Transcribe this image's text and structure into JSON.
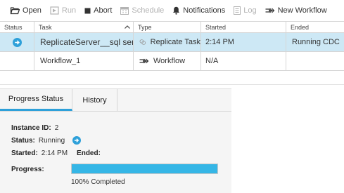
{
  "toolbar": {
    "open": "Open",
    "run": "Run",
    "abort": "Abort",
    "schedule": "Schedule",
    "notifications": "Notifications",
    "log": "Log",
    "new_workflow": "New Workflow"
  },
  "grid": {
    "columns": [
      "Status",
      "Task",
      "Type",
      "Started",
      "Ended"
    ],
    "rows": [
      {
        "task": "ReplicateServer__sql server",
        "type": "Replicate Task",
        "started": "2:14 PM",
        "ended": "Running CDC"
      },
      {
        "task": "Workflow_1",
        "type": "Workflow",
        "started": "N/A",
        "ended": ""
      }
    ]
  },
  "tabs": [
    "Progress Status",
    "History"
  ],
  "details": {
    "instance_label": "Instance ID:",
    "instance_value": "2",
    "status_label": "Status:",
    "status_value": "Running",
    "started_label": "Started:",
    "started_value": "2:14 PM",
    "ended_label": "Ended:",
    "progress_label": "Progress:",
    "progress_percent": 100,
    "progress_text": "100% Completed"
  },
  "colors": {
    "accent": "#2ea0d9",
    "selected_row": "#cde8f5",
    "progress": "#35b6e6"
  }
}
